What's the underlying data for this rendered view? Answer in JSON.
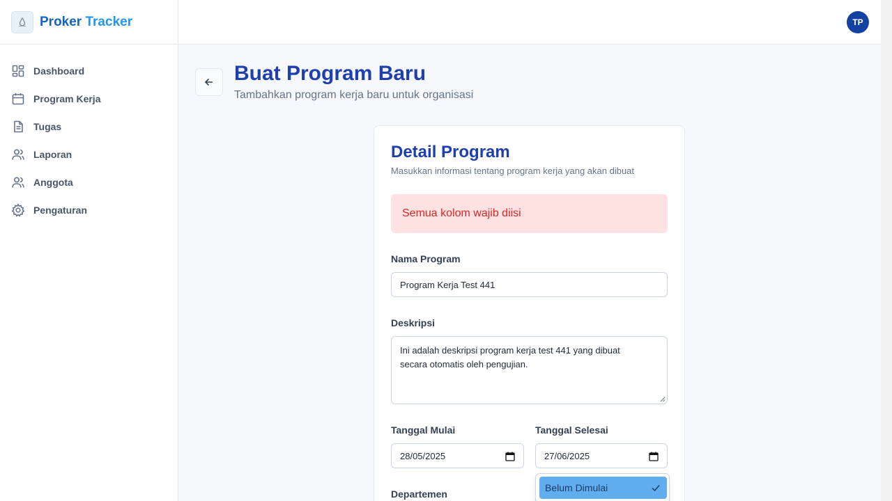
{
  "brand": {
    "name_part1": "Proker",
    "name_part2": "Tracker",
    "logo_icon": "water-drop-logo"
  },
  "sidebar": {
    "items": [
      {
        "label": "Dashboard",
        "icon": "grid-icon"
      },
      {
        "label": "Program Kerja",
        "icon": "calendar-icon"
      },
      {
        "label": "Tugas",
        "icon": "document-icon"
      },
      {
        "label": "Laporan",
        "icon": "users-icon"
      },
      {
        "label": "Anggota",
        "icon": "users-icon"
      },
      {
        "label": "Pengaturan",
        "icon": "gear-icon"
      }
    ]
  },
  "header": {
    "avatar_initials": "TP"
  },
  "page": {
    "title": "Buat Program Baru",
    "subtitle": "Tambahkan program kerja baru untuk organisasi"
  },
  "form": {
    "title": "Detail Program",
    "description": "Masukkan informasi tentang program kerja yang akan dibuat",
    "error_message": "Semua kolom wajib diisi",
    "name_label": "Nama Program",
    "name_value": "Program Kerja Test 441",
    "desc_label": "Deskripsi",
    "desc_value": "Ini adalah deskripsi program kerja test 441 yang dibuat\nsecara otomatis oleh pengujian.",
    "start_label": "Tanggal Mulai",
    "start_value": "28/05/2025",
    "end_label": "Tanggal Selesai",
    "end_value": "27/06/2025",
    "department_label": "Departemen",
    "status_dropdown": {
      "selected_option": "Belum Dimulai"
    }
  },
  "colors": {
    "primary": "#1e40af",
    "brand_blue": "#1565c0",
    "brand_light_blue": "#2196f3",
    "avatar_bg": "#1442a0",
    "alert_bg": "#fee2e2",
    "alert_text": "#dc2626",
    "option_highlight": "#60aef0"
  }
}
